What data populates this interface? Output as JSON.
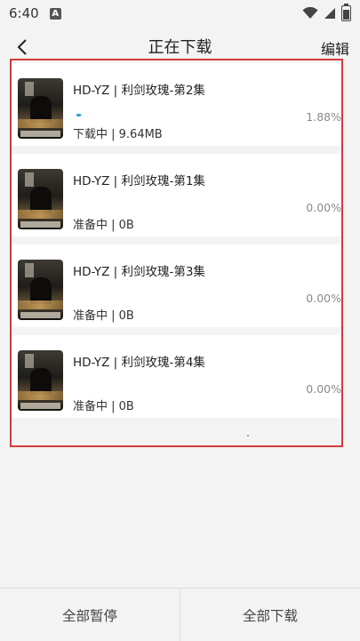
{
  "status_bar": {
    "time": "6:40",
    "badge": "A",
    "icons": [
      "wifi-icon",
      "cell-signal-icon",
      "battery-icon"
    ]
  },
  "header": {
    "title": "正在下载",
    "edit_label": "编辑",
    "back_icon": "chevron-left-icon"
  },
  "downloads": [
    {
      "title": "HD-YZ | 利剑玫瑰-第2集",
      "status": "下载中 | 9.64MB",
      "percent": "1.88%",
      "progress": 0.0188
    },
    {
      "title": "HD-YZ | 利剑玫瑰-第1集",
      "status": "准备中 | 0B",
      "percent": "0.00%",
      "progress": 0
    },
    {
      "title": "HD-YZ | 利剑玫瑰-第3集",
      "status": "准备中 | 0B",
      "percent": "0.00%",
      "progress": 0
    },
    {
      "title": "HD-YZ | 利剑玫瑰-第4集",
      "status": "准备中 | 0B",
      "percent": "0.00%",
      "progress": 0
    }
  ],
  "footer": {
    "pause_all": "全部暂停",
    "download_all": "全部下载"
  },
  "colors": {
    "progress": "#2fa3d3",
    "highlight_border": "#d23b3b"
  }
}
